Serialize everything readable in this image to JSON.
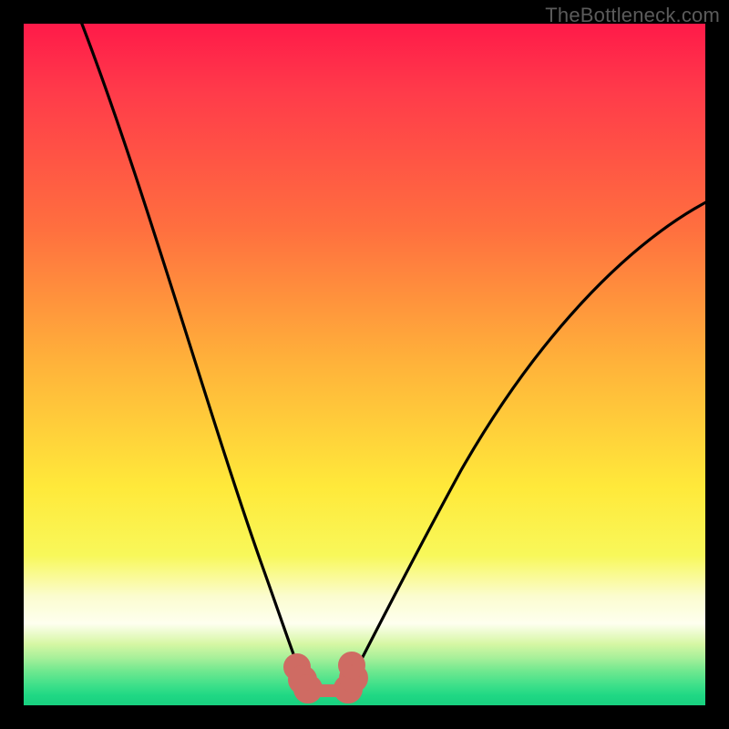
{
  "watermark": "TheBottleneck.com",
  "colors": {
    "frame": "#000000",
    "gradient_top": "#ff1a49",
    "gradient_mid": "#ffe93a",
    "gradient_bottom": "#18d07f",
    "curve_stroke": "#000000",
    "flat_marker": "#cf6b63"
  },
  "chart_data": {
    "type": "line",
    "title": "",
    "xlabel": "",
    "ylabel": "",
    "xlim": [
      0,
      100
    ],
    "ylim": [
      0,
      100
    ],
    "x": [
      8,
      12,
      16,
      20,
      24,
      28,
      32,
      35,
      37,
      39,
      40,
      41,
      42,
      43,
      44,
      45,
      46,
      48,
      50,
      52,
      55,
      60,
      65,
      70,
      75,
      80,
      85,
      90,
      95,
      100
    ],
    "values": [
      100,
      90,
      80,
      70,
      60,
      50,
      40,
      30,
      22,
      14,
      8,
      4,
      2,
      1,
      1,
      1,
      2,
      4,
      8,
      14,
      22,
      32,
      40,
      47,
      53,
      58,
      62,
      65,
      68,
      70
    ],
    "flat_region": {
      "x_start": 39,
      "x_end": 48,
      "y": 3
    },
    "annotations": [
      "TheBottleneck.com"
    ]
  }
}
